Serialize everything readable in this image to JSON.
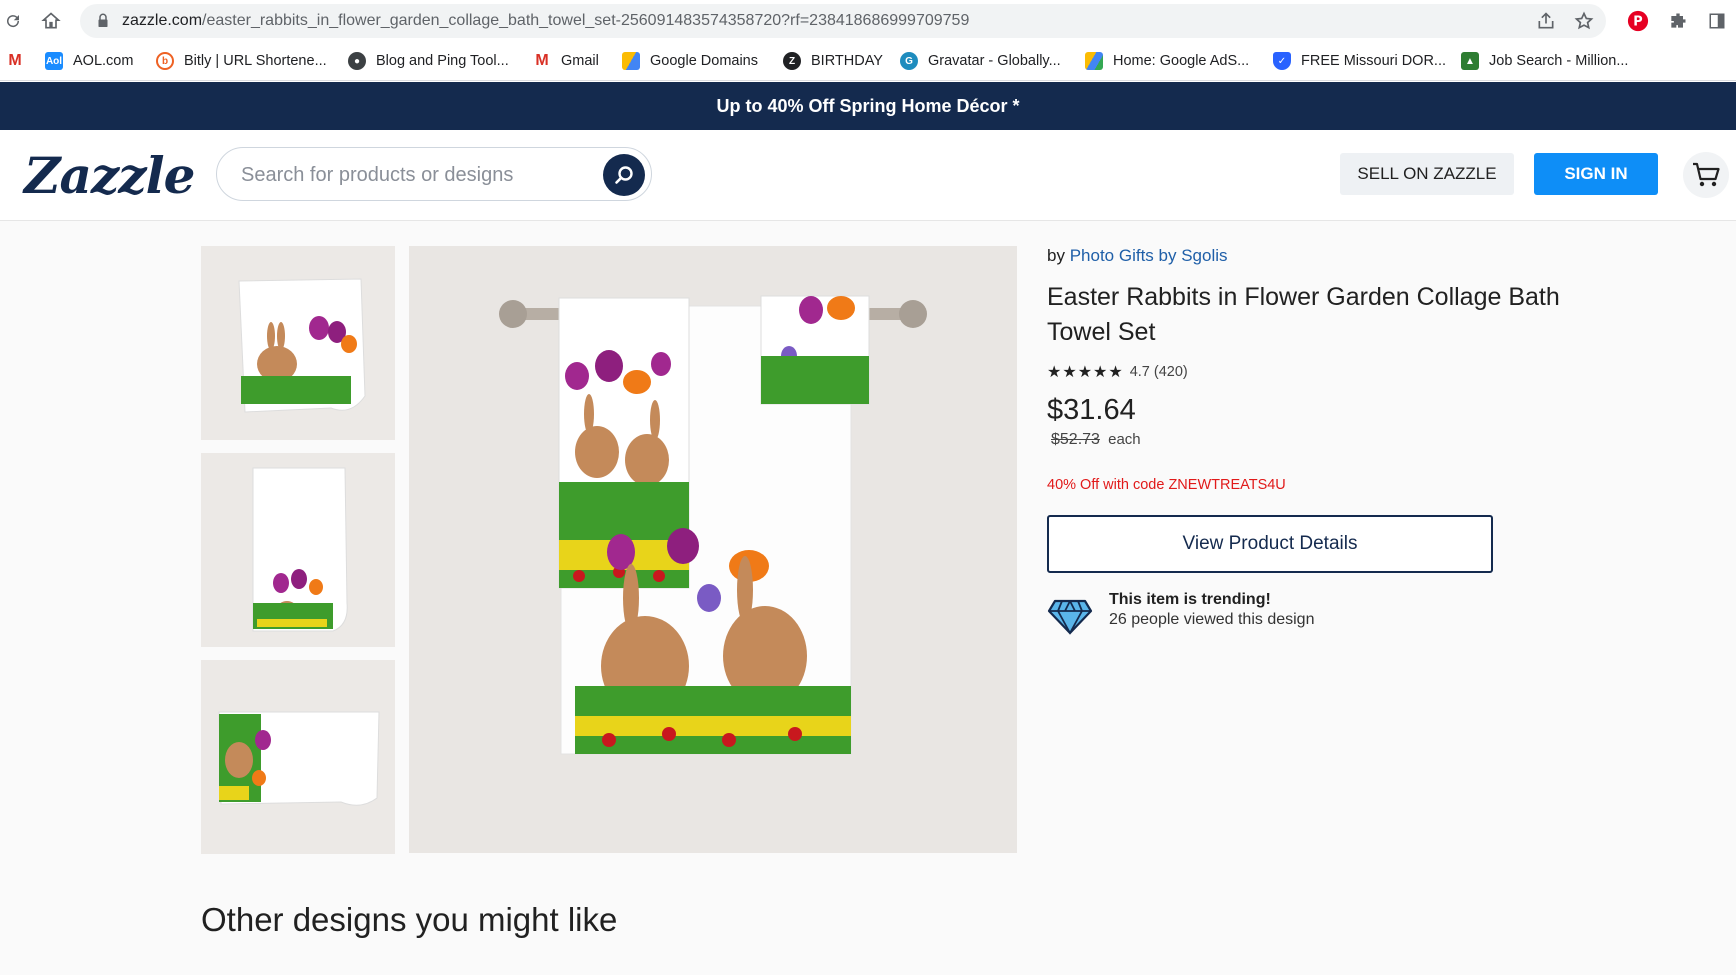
{
  "browser": {
    "url_host": "zazzle.com",
    "url_path": "/easter_rabbits_in_flower_garden_collage_bath_towel_set-256091483574358720?rf=238418686999709759",
    "bookmarks": [
      {
        "label": "",
        "icon": "gmail-icon"
      },
      {
        "label": "AOL.com",
        "icon": "aol-icon"
      },
      {
        "label": "Bitly | URL Shortene...",
        "icon": "bitly-icon"
      },
      {
        "label": "Blog and Ping Tool...",
        "icon": "globe-icon"
      },
      {
        "label": "Gmail",
        "icon": "gmail-icon"
      },
      {
        "label": "Google Domains",
        "icon": "google-domains-icon"
      },
      {
        "label": "BIRTHDAY",
        "icon": "birthday-icon"
      },
      {
        "label": "Gravatar - Globally...",
        "icon": "gravatar-icon"
      },
      {
        "label": "Home: Google AdS...",
        "icon": "google-ads-icon"
      },
      {
        "label": "FREE Missouri DOR...",
        "icon": "shield-icon"
      },
      {
        "label": "Job Search - Million...",
        "icon": "job-icon"
      }
    ]
  },
  "promo_banner": "Up to 40% Off Spring Home Décor *",
  "header": {
    "logo": "Zazzle",
    "search_placeholder": "Search for products or designs",
    "sell_label": "SELL ON ZAZZLE",
    "signin_label": "SIGN IN"
  },
  "product": {
    "by_prefix": "by",
    "seller": "Photo Gifts by Sgolis",
    "title": "Easter Rabbits in Flower Garden Collage Bath Towel Set",
    "stars": "★★★★★",
    "rating": "4.7 (420)",
    "price": "$31.64",
    "original_price": "$52.73",
    "price_unit": "each",
    "promo_code_text": "40% Off with code ZNEWTREATS4U",
    "details_button": "View Product Details",
    "trending_title": "This item is trending!",
    "trending_sub": "26 people viewed this design"
  },
  "other_heading": "Other designs you might like",
  "colors": {
    "navy": "#142a4e",
    "blue": "#0e8ef7",
    "promo_red": "#e11a1a"
  }
}
